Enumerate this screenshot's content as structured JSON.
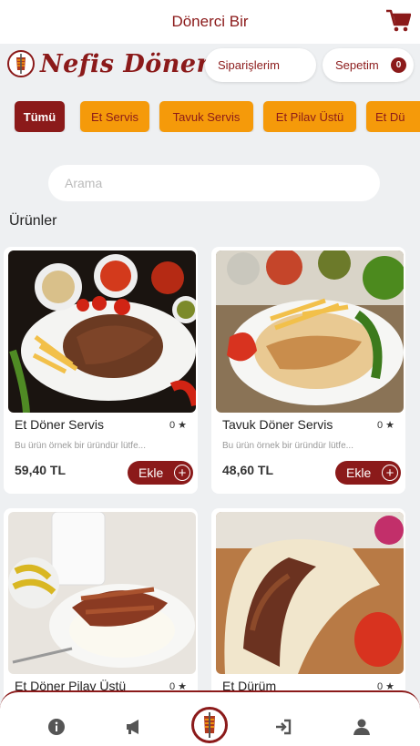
{
  "header": {
    "title": "Dönerci Bir",
    "cart_icon": "cart-icon"
  },
  "brand": {
    "name": "Nefis Döner",
    "logo_icon": "doner-logo-icon"
  },
  "nav_pills": {
    "orders_label": "Siparişlerim",
    "cart_label": "Sepetim",
    "cart_count": "0"
  },
  "categories": [
    {
      "label": "Tümü",
      "active": true
    },
    {
      "label": "Et Servis",
      "active": false
    },
    {
      "label": "Tavuk Servis",
      "active": false
    },
    {
      "label": "Et Pilav Üstü",
      "active": false
    },
    {
      "label": "Et Dü",
      "active": false
    }
  ],
  "search": {
    "placeholder": "Arama"
  },
  "section_title": "Ürünler",
  "products": [
    {
      "name": "Et Döner Servis",
      "rating": "0 ★",
      "desc": "Bu ürün örnek bir üründür lütfe...",
      "price": "59,40 TL",
      "add_label": "Ekle"
    },
    {
      "name": "Tavuk Döner Servis",
      "rating": "0 ★",
      "desc": "Bu ürün örnek bir üründür lütfe...",
      "price": "48,60 TL",
      "add_label": "Ekle"
    },
    {
      "name": "Et Döner Pilav Üstü",
      "rating": "0 ★",
      "desc": "",
      "price": "",
      "add_label": ""
    },
    {
      "name": "Et Dürüm",
      "rating": "0 ★",
      "desc": "",
      "price": "",
      "add_label": ""
    }
  ],
  "bottom_nav": [
    "info-icon",
    "megaphone-icon",
    "home-logo-icon",
    "login-icon",
    "user-icon"
  ],
  "colors": {
    "brand": "#8b1a1a",
    "accent": "#f59a0a",
    "background": "#eef0f2"
  }
}
